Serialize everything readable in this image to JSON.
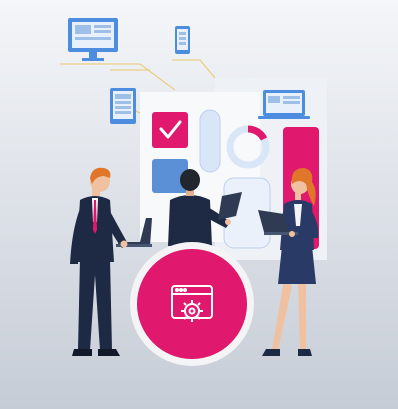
{
  "illustration": {
    "theme": "Web application development team",
    "icons": [
      "desktop-monitor-icon",
      "smartphone-icon",
      "tablet-icon",
      "laptop-screen-icon",
      "checkmark-icon",
      "browser-settings-gear-icon"
    ],
    "colors": {
      "background_top": "#f4f6f9",
      "background_bottom": "#c6ccd6",
      "accent_pink": "#e0186e",
      "accent_blue": "#5b8fd6",
      "light_blue": "#d9e6f7",
      "panel": "#f2f4f8",
      "suit_navy": "#1e2a44",
      "skin": "#f0c1a0",
      "hair_orange": "#e0762a",
      "hair_dark": "#22262f"
    },
    "gear_badge": {
      "icon": "browser-settings-gear-icon",
      "ring_color": "#f4f4f6",
      "fill_color": "#e0186e"
    }
  }
}
